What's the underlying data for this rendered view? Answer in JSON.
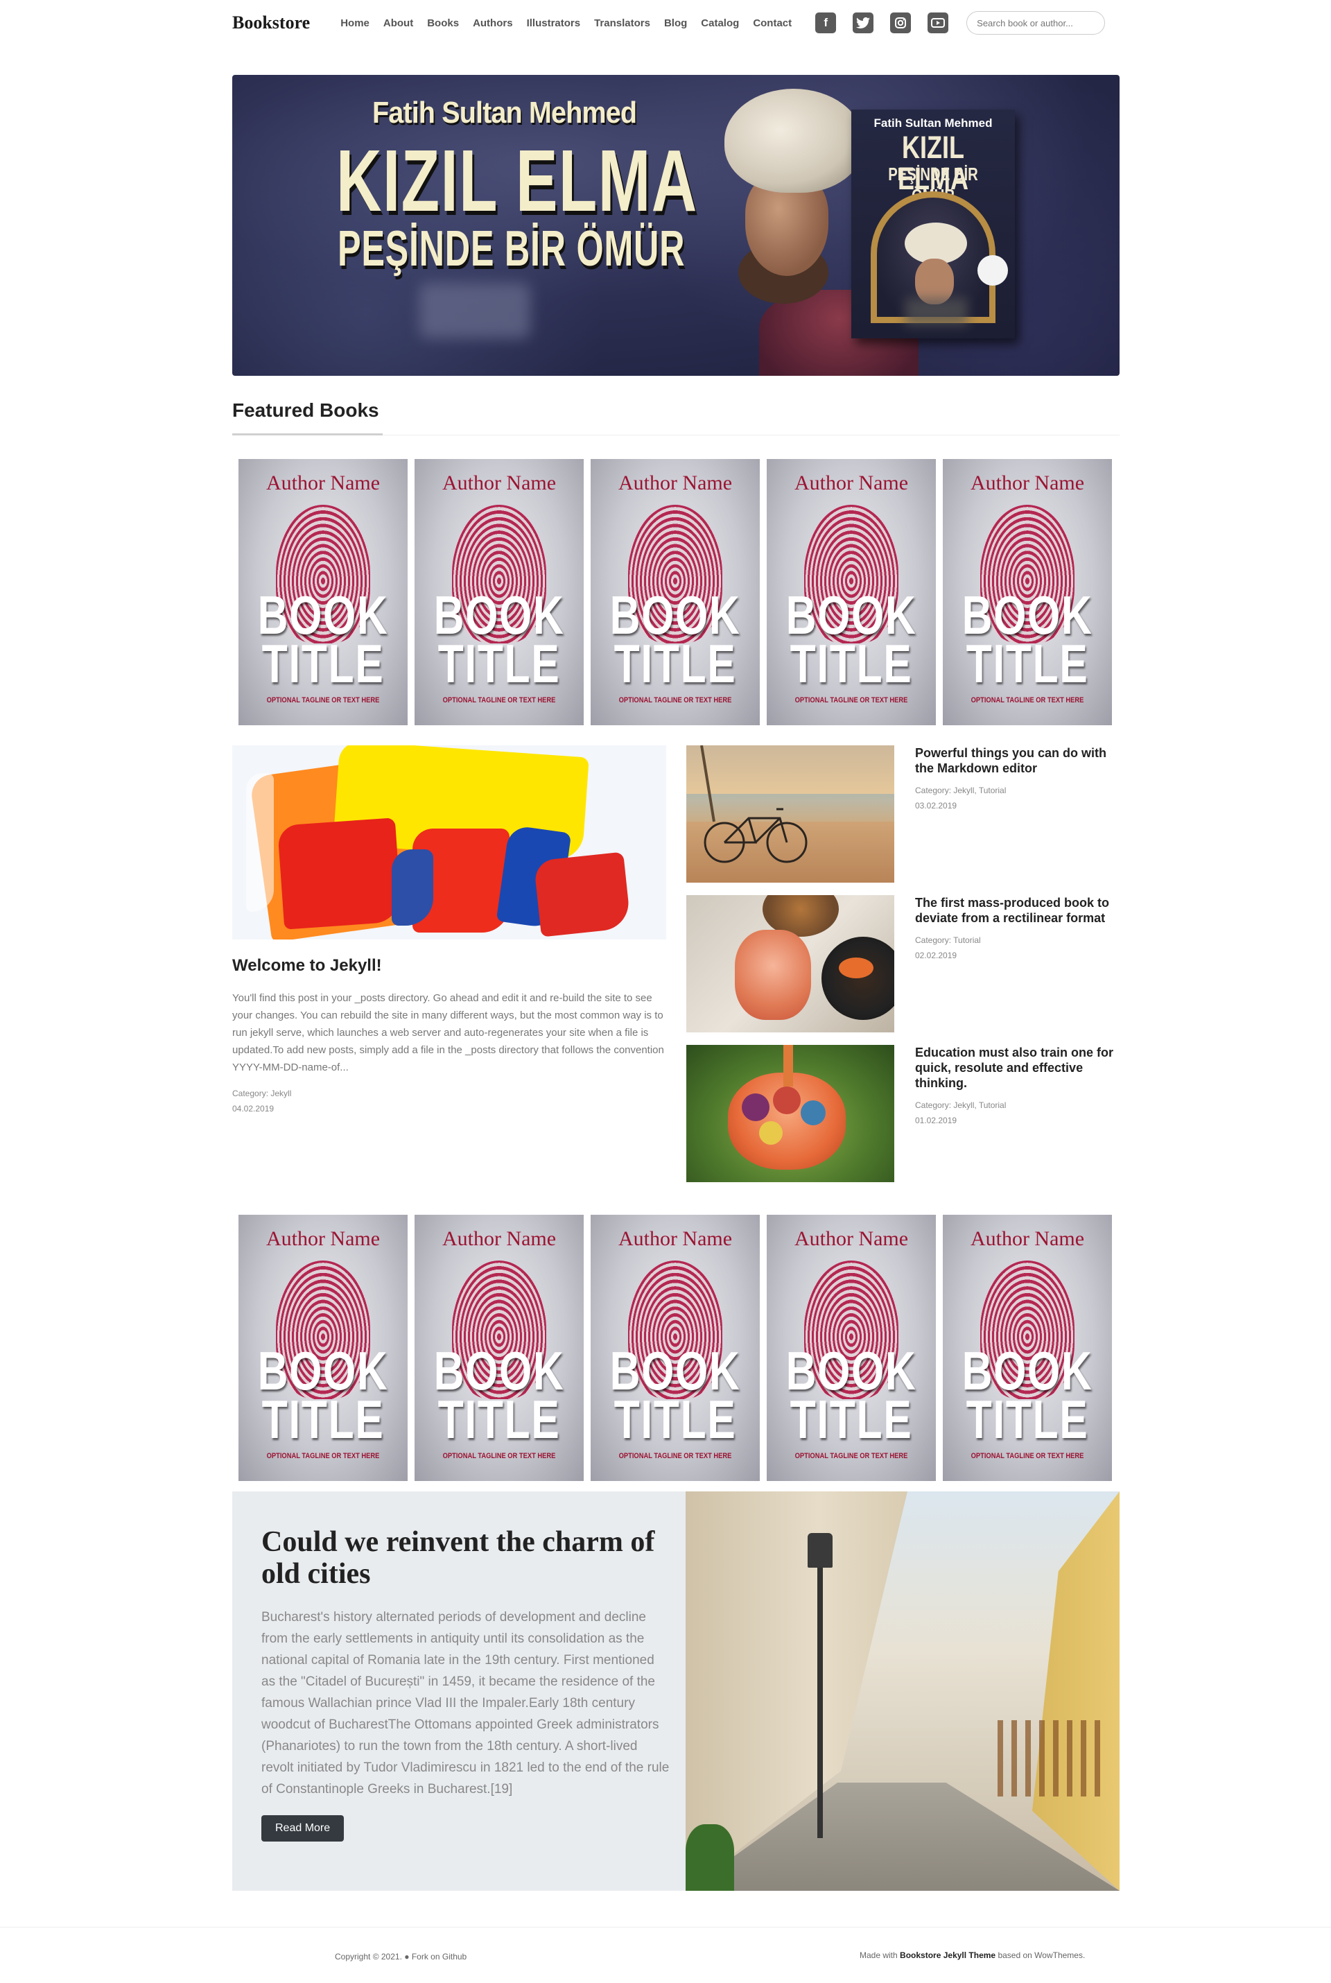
{
  "nav": {
    "brand": "Bookstore",
    "links": [
      "Home",
      "About",
      "Books",
      "Authors",
      "Illustrators",
      "Translators",
      "Blog",
      "Catalog",
      "Contact"
    ],
    "socials": [
      "facebook-icon",
      "twitter-icon",
      "instagram-icon",
      "youtube-icon"
    ],
    "search_placeholder": "Search book or author..."
  },
  "hero": {
    "author": "Fatih Sultan Mehmed",
    "title_line1": "KIZIL ELMA",
    "title_line2": "PEŞİNDE BİR ÖMÜR",
    "book_author": "Fatih Sultan Mehmed",
    "book_title1": "KIZIL ELMA",
    "book_title2": "PEŞİNDE BİR ÖMÜR"
  },
  "featured": {
    "heading": "Featured Books",
    "book": {
      "author": "Author Name",
      "title1": "BOOK",
      "title2": "TITLE",
      "tagline": "OPTIONAL TAGLINE OR TEXT HERE"
    }
  },
  "main_post": {
    "title": "Welcome to Jekyll!",
    "excerpt": "You'll find this post in your _posts directory. Go ahead and edit it and re-build the site to see your changes. You can rebuild the site in many different ways, but the most common way is to run jekyll serve, which launches a web server and auto-regenerates your site when a file is updated.To add new posts, simply add a file in the _posts directory that follows the convention YYYY-MM-DD-name-of...",
    "category": "Category: Jekyll",
    "date": "04.02.2019"
  },
  "side_posts": [
    {
      "title": "Powerful things you can do with the Markdown editor",
      "category": "Category: Jekyll, Tutorial",
      "date": "03.02.2019"
    },
    {
      "title": "The first mass-produced book to deviate from a rectilinear format",
      "category": "Category: Tutorial",
      "date": "02.02.2019"
    },
    {
      "title": "Education must also train one for quick, resolute and effective thinking.",
      "category": "Category: Jekyll, Tutorial",
      "date": "01.02.2019"
    }
  ],
  "feature": {
    "title": "Could we reinvent the charm of old cities",
    "body": "Bucharest's history alternated periods of development and decline from the early settlements in antiquity until its consolidation as the national capital of Romania late in the 19th century. First mentioned as the \"Citadel of București\" in 1459, it became the residence of the famous Wallachian prince Vlad III the Impaler.Early 18th century woodcut of BucharestThe Ottomans appointed Greek administrators (Phanariotes) to run the town from the 18th century. A short-lived revolt initiated by Tudor Vladimirescu in 1821 led to the end of the rule of Constantinople Greeks in Bucharest.[19]",
    "button": "Read More"
  },
  "footer": {
    "copyright": "Copyright © 2021.",
    "fork": "Fork on Github",
    "made_with": "Made with",
    "theme": "Bookstore Jekyll Theme",
    "based_on": "based on WowThemes."
  }
}
